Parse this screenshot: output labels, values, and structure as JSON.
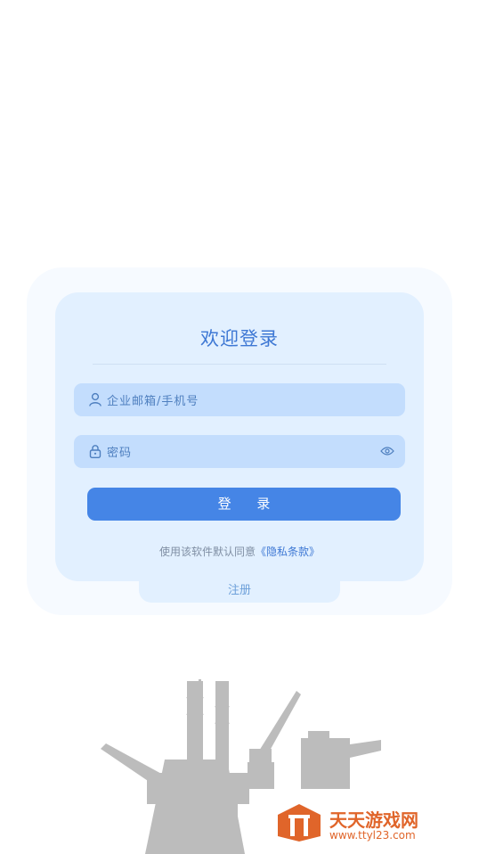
{
  "login": {
    "title": "欢迎登录",
    "account_placeholder": "企业邮箱/手机号",
    "password_placeholder": "密码",
    "login_label": "登 录",
    "agree_text": "使用该软件默认同意",
    "privacy_link": "《隐私条款》",
    "register_label": "注册"
  },
  "watermark": {
    "title": "天天游戏网",
    "url": "www.ttyl23.com"
  },
  "colors": {
    "accent": "#4585e6",
    "card_bg": "#e2f0ff",
    "field_bg": "#c3ddfd"
  }
}
